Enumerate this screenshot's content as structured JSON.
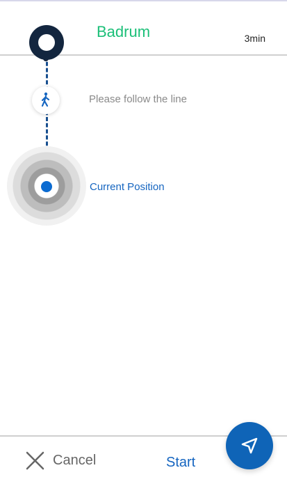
{
  "header": {
    "destination": "Badrum",
    "duration": "3min"
  },
  "route": {
    "instruction": "Please follow the line",
    "current_position_label": "Current Position"
  },
  "footer": {
    "cancel_label": "Cancel",
    "start_label": "Start"
  },
  "icons": {
    "destination": "destination-pin-icon",
    "walking": "walking-icon",
    "cancel": "close-icon",
    "navigate": "navigation-arrow-icon"
  },
  "colors": {
    "destination_title": "#1bbf78",
    "route_line": "#184f8f",
    "current_position": "#0b6bd1",
    "primary_action": "#1565c0",
    "fab_background": "#0f64b7",
    "pin": "#13263f"
  }
}
